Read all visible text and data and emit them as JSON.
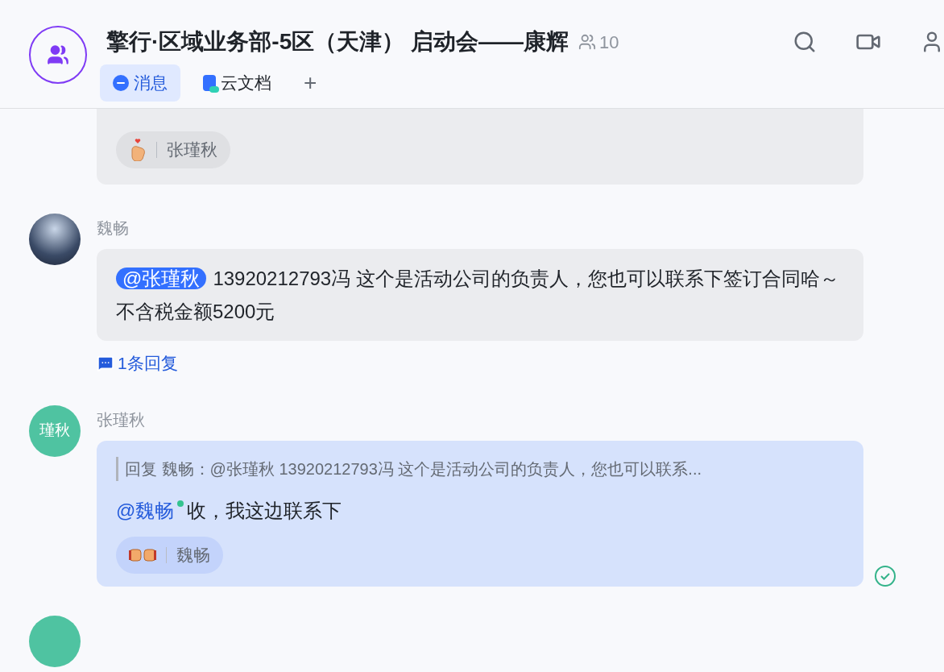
{
  "header": {
    "title": "擎行·区域业务部-5区（天津） 启动会——康辉",
    "member_count": "10",
    "tabs": [
      {
        "label": "消息",
        "kind": "chat",
        "selected": true
      },
      {
        "label": "云文档",
        "kind": "docs",
        "selected": false
      }
    ],
    "add_tab": "+"
  },
  "messages": [
    {
      "kind": "partial",
      "reactions": [
        {
          "kind": "finger-heart",
          "user": "张瑾秋"
        }
      ]
    },
    {
      "kind": "message",
      "sender": "魏畅",
      "mention": "@张瑾秋",
      "text": "13920212793冯 这个是活动公司的负责人，您也可以联系下签订合同哈～不含税金额5200元",
      "own": false,
      "thread": "1条回复"
    },
    {
      "kind": "message",
      "sender": "张瑾秋",
      "initials": "瑾秋",
      "own": true,
      "quote": "回复 魏畅：@张瑾秋 13920212793冯 这个是活动公司的负责人，您也可以联系...",
      "mention": "@魏畅",
      "mention_online": true,
      "text": "收，我这边联系下",
      "reactions": [
        {
          "kind": "fist-bump",
          "user": "魏畅"
        }
      ],
      "read": true
    }
  ]
}
